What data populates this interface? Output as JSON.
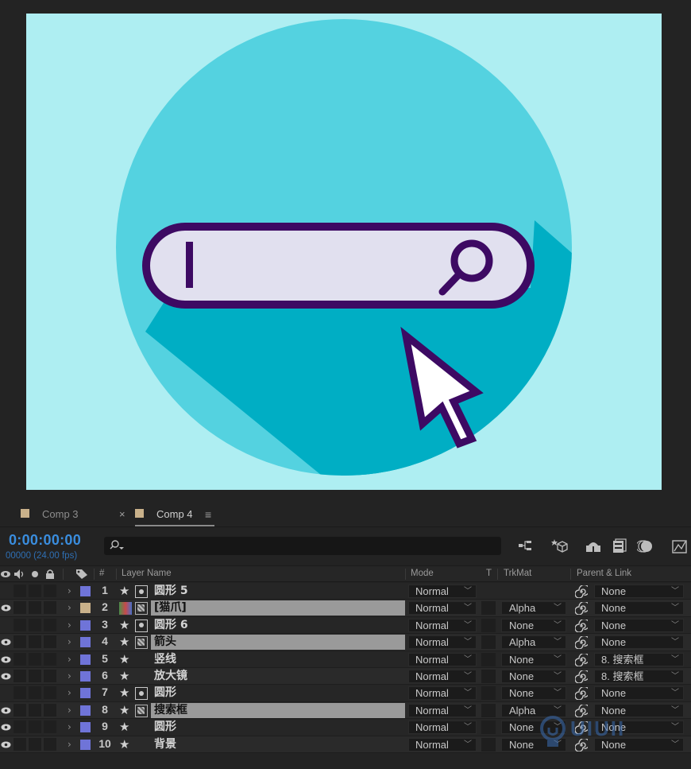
{
  "tabs": [
    {
      "label": "Comp 3",
      "active": false,
      "swatch": "#c9b18a"
    },
    {
      "label": "Comp 4",
      "active": true,
      "swatch": "#c9b18a"
    }
  ],
  "timeline": {
    "timecode": "0:00:00:00",
    "frames": "00000 (24.00 fps)",
    "search_icon": "search-icon"
  },
  "columns": {
    "num": "#",
    "layer_name": "Layer Name",
    "mode": "Mode",
    "t": "T",
    "trkmat": "TrkMat",
    "parent": "Parent & Link"
  },
  "layers": [
    {
      "num": "1",
      "name": "圆形 5",
      "type": "shape",
      "label_color": "#6f74d8",
      "mode": "Normal",
      "trkmat": "",
      "parent": "None",
      "selected": false,
      "eye": false
    },
    {
      "num": "2",
      "name": "[猫爪]",
      "type": "precomp",
      "label_color": "#c9b18a",
      "mode": "Normal",
      "trkmat": "Alpha",
      "parent": "None",
      "selected": true,
      "eye": true
    },
    {
      "num": "3",
      "name": "圆形 6",
      "type": "shape",
      "label_color": "#6f74d8",
      "mode": "Normal",
      "trkmat": "None",
      "parent": "None",
      "selected": false,
      "eye": false
    },
    {
      "num": "4",
      "name": "箭头",
      "type": "precomp",
      "label_color": "#6f74d8",
      "mode": "Normal",
      "trkmat": "Alpha",
      "parent": "None",
      "selected": true,
      "eye": true
    },
    {
      "num": "5",
      "name": "竖线",
      "type": "star",
      "label_color": "#6f74d8",
      "mode": "Normal",
      "trkmat": "None",
      "parent": "8. 搜索框",
      "selected": false,
      "eye": true
    },
    {
      "num": "6",
      "name": "放大镜",
      "type": "star",
      "label_color": "#6f74d8",
      "mode": "Normal",
      "trkmat": "None",
      "parent": "8. 搜索框",
      "selected": false,
      "eye": true
    },
    {
      "num": "7",
      "name": "圆形",
      "type": "shape",
      "label_color": "#6f74d8",
      "mode": "Normal",
      "trkmat": "None",
      "parent": "None",
      "selected": false,
      "eye": false
    },
    {
      "num": "8",
      "name": "搜索框",
      "type": "precomp",
      "label_color": "#6f74d8",
      "mode": "Normal",
      "trkmat": "Alpha",
      "parent": "None",
      "selected": true,
      "eye": true
    },
    {
      "num": "9",
      "name": "圆形",
      "type": "star",
      "label_color": "#6f74d8",
      "mode": "Normal",
      "trkmat": "None",
      "parent": "None",
      "selected": false,
      "eye": true
    },
    {
      "num": "10",
      "name": "背景",
      "type": "star",
      "label_color": "#6f74d8",
      "mode": "Normal",
      "trkmat": "None",
      "parent": "None",
      "selected": false,
      "eye": true
    }
  ],
  "watermark": "UIUII",
  "colors": {
    "canvas_bg": "#aeeef2",
    "circle": "#54d2e0",
    "shadow": "#00aec4",
    "bar_fill": "#e1e0ef",
    "stroke": "#3d0a63",
    "timecode": "#3a8dde"
  }
}
